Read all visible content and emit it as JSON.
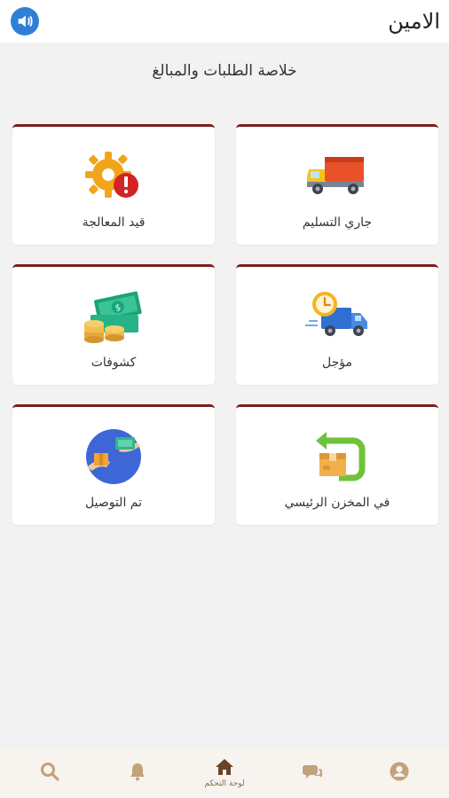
{
  "header": {
    "title": "الامين",
    "speaker_icon": "speaker-icon"
  },
  "summary": {
    "title": "خلاصة الطلبات والمبالغ"
  },
  "cards": [
    {
      "label": "جاري التسليم",
      "icon": "delivery-truck-icon"
    },
    {
      "label": "قيد المعالجة",
      "icon": "gear-warning-icon"
    },
    {
      "label": "مؤجل",
      "icon": "delayed-truck-clock-icon"
    },
    {
      "label": "كشوفات",
      "icon": "money-coins-icon"
    },
    {
      "label": "في المخزن الرئيسي",
      "icon": "warehouse-return-box-icon"
    },
    {
      "label": "تم التوصيل",
      "icon": "hand-over-package-icon"
    }
  ],
  "bottom_nav": {
    "items": [
      {
        "icon": "user-icon",
        "label": ""
      },
      {
        "icon": "chat-icon",
        "label": ""
      },
      {
        "icon": "home-icon",
        "label": "لوحة التحكم"
      },
      {
        "icon": "bell-icon",
        "label": ""
      },
      {
        "icon": "search-icon",
        "label": ""
      }
    ]
  },
  "colors": {
    "accent_border": "#7a1f1f",
    "nav_icon": "#c2a27b",
    "nav_active": "#6a4424",
    "speaker_bg": "#2f7fd6"
  }
}
